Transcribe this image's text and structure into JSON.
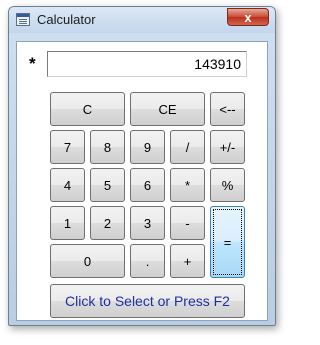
{
  "window": {
    "title": "Calculator",
    "close_glyph": "x"
  },
  "display": {
    "operator": "*",
    "value": "143910"
  },
  "buttons": {
    "c": "C",
    "ce": "CE",
    "backspace": "<--",
    "n7": "7",
    "n8": "8",
    "n9": "9",
    "divide": "/",
    "sign": "+/-",
    "n4": "4",
    "n5": "5",
    "n6": "6",
    "multiply": "*",
    "percent": "%",
    "n1": "1",
    "n2": "2",
    "n3": "3",
    "subtract": "-",
    "equals": "=",
    "n0": "0",
    "decimal": ".",
    "add": "+",
    "select": "Click to Select or Press F2"
  },
  "icons": {
    "app": "calculator-app-icon",
    "close": "close-icon"
  },
  "colors": {
    "select_text": "#1c2f9e",
    "close_button": "#c74a35",
    "focused_button": "#bee6fd"
  }
}
